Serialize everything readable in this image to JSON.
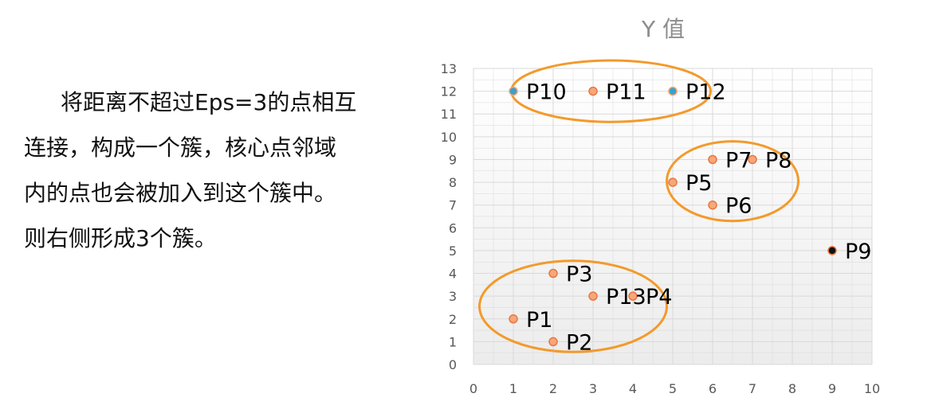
{
  "description": {
    "lines": [
      "将距离不超过Eps=3的点相互",
      "连接，构成一个簇，核心点邻域",
      "内的点也会被加入到这个簇中。",
      "则右侧形成3个簇。"
    ]
  },
  "chart_data": {
    "type": "scatter",
    "title": "Y 值",
    "xlabel": "",
    "ylabel": "",
    "xlim": [
      0,
      10
    ],
    "ylim": [
      0,
      13
    ],
    "grid": true,
    "x_ticks": [
      "0",
      "1",
      "2",
      "3",
      "4",
      "5",
      "6",
      "7",
      "8",
      "9",
      "10"
    ],
    "y_ticks": [
      "0",
      "1",
      "2",
      "3",
      "4",
      "5",
      "6",
      "7",
      "8",
      "9",
      "10",
      "11",
      "12",
      "13"
    ],
    "points": [
      {
        "label": "P1",
        "x": 1,
        "y": 2,
        "type": "border"
      },
      {
        "label": "P2",
        "x": 2,
        "y": 1,
        "type": "border"
      },
      {
        "label": "P3",
        "x": 2,
        "y": 4,
        "type": "border"
      },
      {
        "label": "P4",
        "x": 4,
        "y": 3,
        "type": "border"
      },
      {
        "label": "P5",
        "x": 5,
        "y": 8,
        "type": "border"
      },
      {
        "label": "P6",
        "x": 6,
        "y": 7,
        "type": "border"
      },
      {
        "label": "P7",
        "x": 6,
        "y": 9,
        "type": "border"
      },
      {
        "label": "P8",
        "x": 7,
        "y": 9,
        "type": "border"
      },
      {
        "label": "P9",
        "x": 9,
        "y": 5,
        "type": "noise"
      },
      {
        "label": "P10",
        "x": 1,
        "y": 12,
        "type": "core"
      },
      {
        "label": "P11",
        "x": 3,
        "y": 12,
        "type": "border"
      },
      {
        "label": "P12",
        "x": 5,
        "y": 12,
        "type": "core"
      },
      {
        "label": "P13",
        "x": 3,
        "y": 3,
        "type": "border"
      }
    ],
    "clusters": [
      {
        "cx": 2.5,
        "cy": 2.55,
        "rx": 2.35,
        "ry": 2.0
      },
      {
        "cx": 6.5,
        "cy": 8.05,
        "rx": 1.65,
        "ry": 1.75
      },
      {
        "cx": 3.45,
        "cy": 12.0,
        "rx": 2.5,
        "ry": 1.35
      }
    ],
    "colors": {
      "border_fill": "#f6a77c",
      "border_stroke": "#e8773e",
      "core_fill": "#3aa0cf",
      "core_stroke": "#f5a46f",
      "noise_fill": "#111111",
      "noise_stroke": "#e8773e",
      "cluster_outline": "#f39a2b",
      "grid": "#d9d9d9",
      "tick_text": "#595959",
      "title_text": "#8c8c8c"
    }
  }
}
